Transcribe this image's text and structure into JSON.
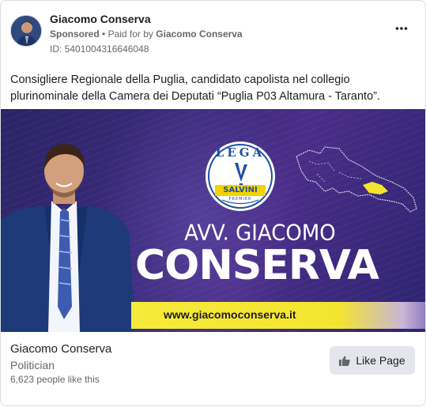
{
  "post": {
    "page_name": "Giacomo Conserva",
    "sponsored_label": "Sponsored",
    "paid_for_prefix": "Paid for by",
    "paid_for_by": "Giacomo Conserva",
    "separator": "•",
    "ad_id": "ID: 5401004316646048",
    "more_icon": "more-horizontal-icon",
    "body_text": "Consigliere Regionale della Puglia, candidato capolista nel collegio plurinominale della Camera dei Deputati “Puglia P03 Altamura - Taranto”."
  },
  "creative": {
    "logo_top": "LEGA",
    "logo_band": "SALVINI",
    "logo_sub": "PREMIER",
    "headline_top": "AVV. GIACOMO",
    "headline_main": "CONSERVA",
    "url": "www.giacomoconserva.it",
    "colors": {
      "background": "#3a2a7a",
      "url_bar": "#f3e52f",
      "logo_blue": "#1f4fa3",
      "logo_yellow": "#f5d300"
    }
  },
  "footer": {
    "name": "Giacomo Conserva",
    "category": "Politician",
    "likes": "6,623 people like this",
    "like_button": "Like Page",
    "like_icon": "thumbs-up-icon"
  }
}
